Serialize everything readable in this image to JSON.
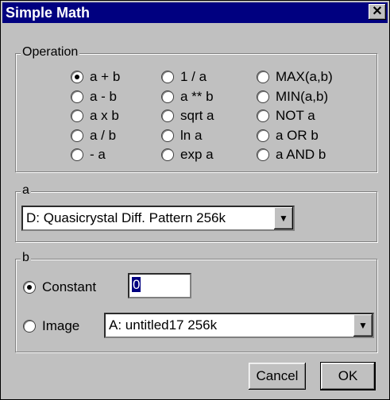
{
  "window": {
    "title": "Simple Math",
    "close_glyph": "✕"
  },
  "operation": {
    "legend": "Operation",
    "columns": [
      [
        {
          "label": "a + b",
          "checked": true
        },
        {
          "label": "a - b"
        },
        {
          "label": "a x b"
        },
        {
          "label": "a / b"
        },
        {
          "label": "- a"
        }
      ],
      [
        {
          "label": "1 / a"
        },
        {
          "label": "a ** b"
        },
        {
          "label": "sqrt a"
        },
        {
          "label": "ln a"
        },
        {
          "label": "exp a"
        }
      ],
      [
        {
          "label": "MAX(a,b)"
        },
        {
          "label": "MIN(a,b)"
        },
        {
          "label": "NOT a"
        },
        {
          "label": "a OR b"
        },
        {
          "label": "a AND b"
        }
      ]
    ]
  },
  "a": {
    "legend": "a",
    "selected": "D: Quasicrystal Diff. Pattern  256k"
  },
  "b": {
    "legend": "b",
    "constant_label": "Constant",
    "constant_value": "0",
    "constant_checked": true,
    "image_label": "Image",
    "image_selected": "A: untitled17  256k"
  },
  "buttons": {
    "cancel": "Cancel",
    "ok": "OK"
  }
}
